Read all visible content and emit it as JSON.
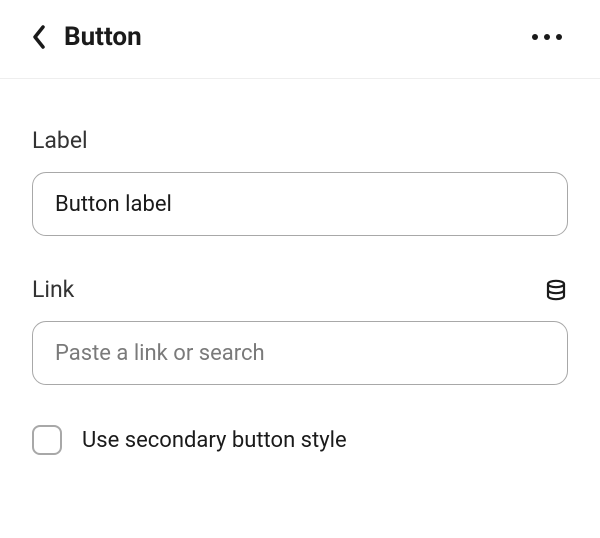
{
  "header": {
    "title": "Button"
  },
  "form": {
    "label_field": {
      "label": "Label",
      "value": "Button label"
    },
    "link_field": {
      "label": "Link",
      "placeholder": "Paste a link or search",
      "value": ""
    },
    "secondary_style": {
      "label": "Use secondary button style",
      "checked": false
    }
  }
}
